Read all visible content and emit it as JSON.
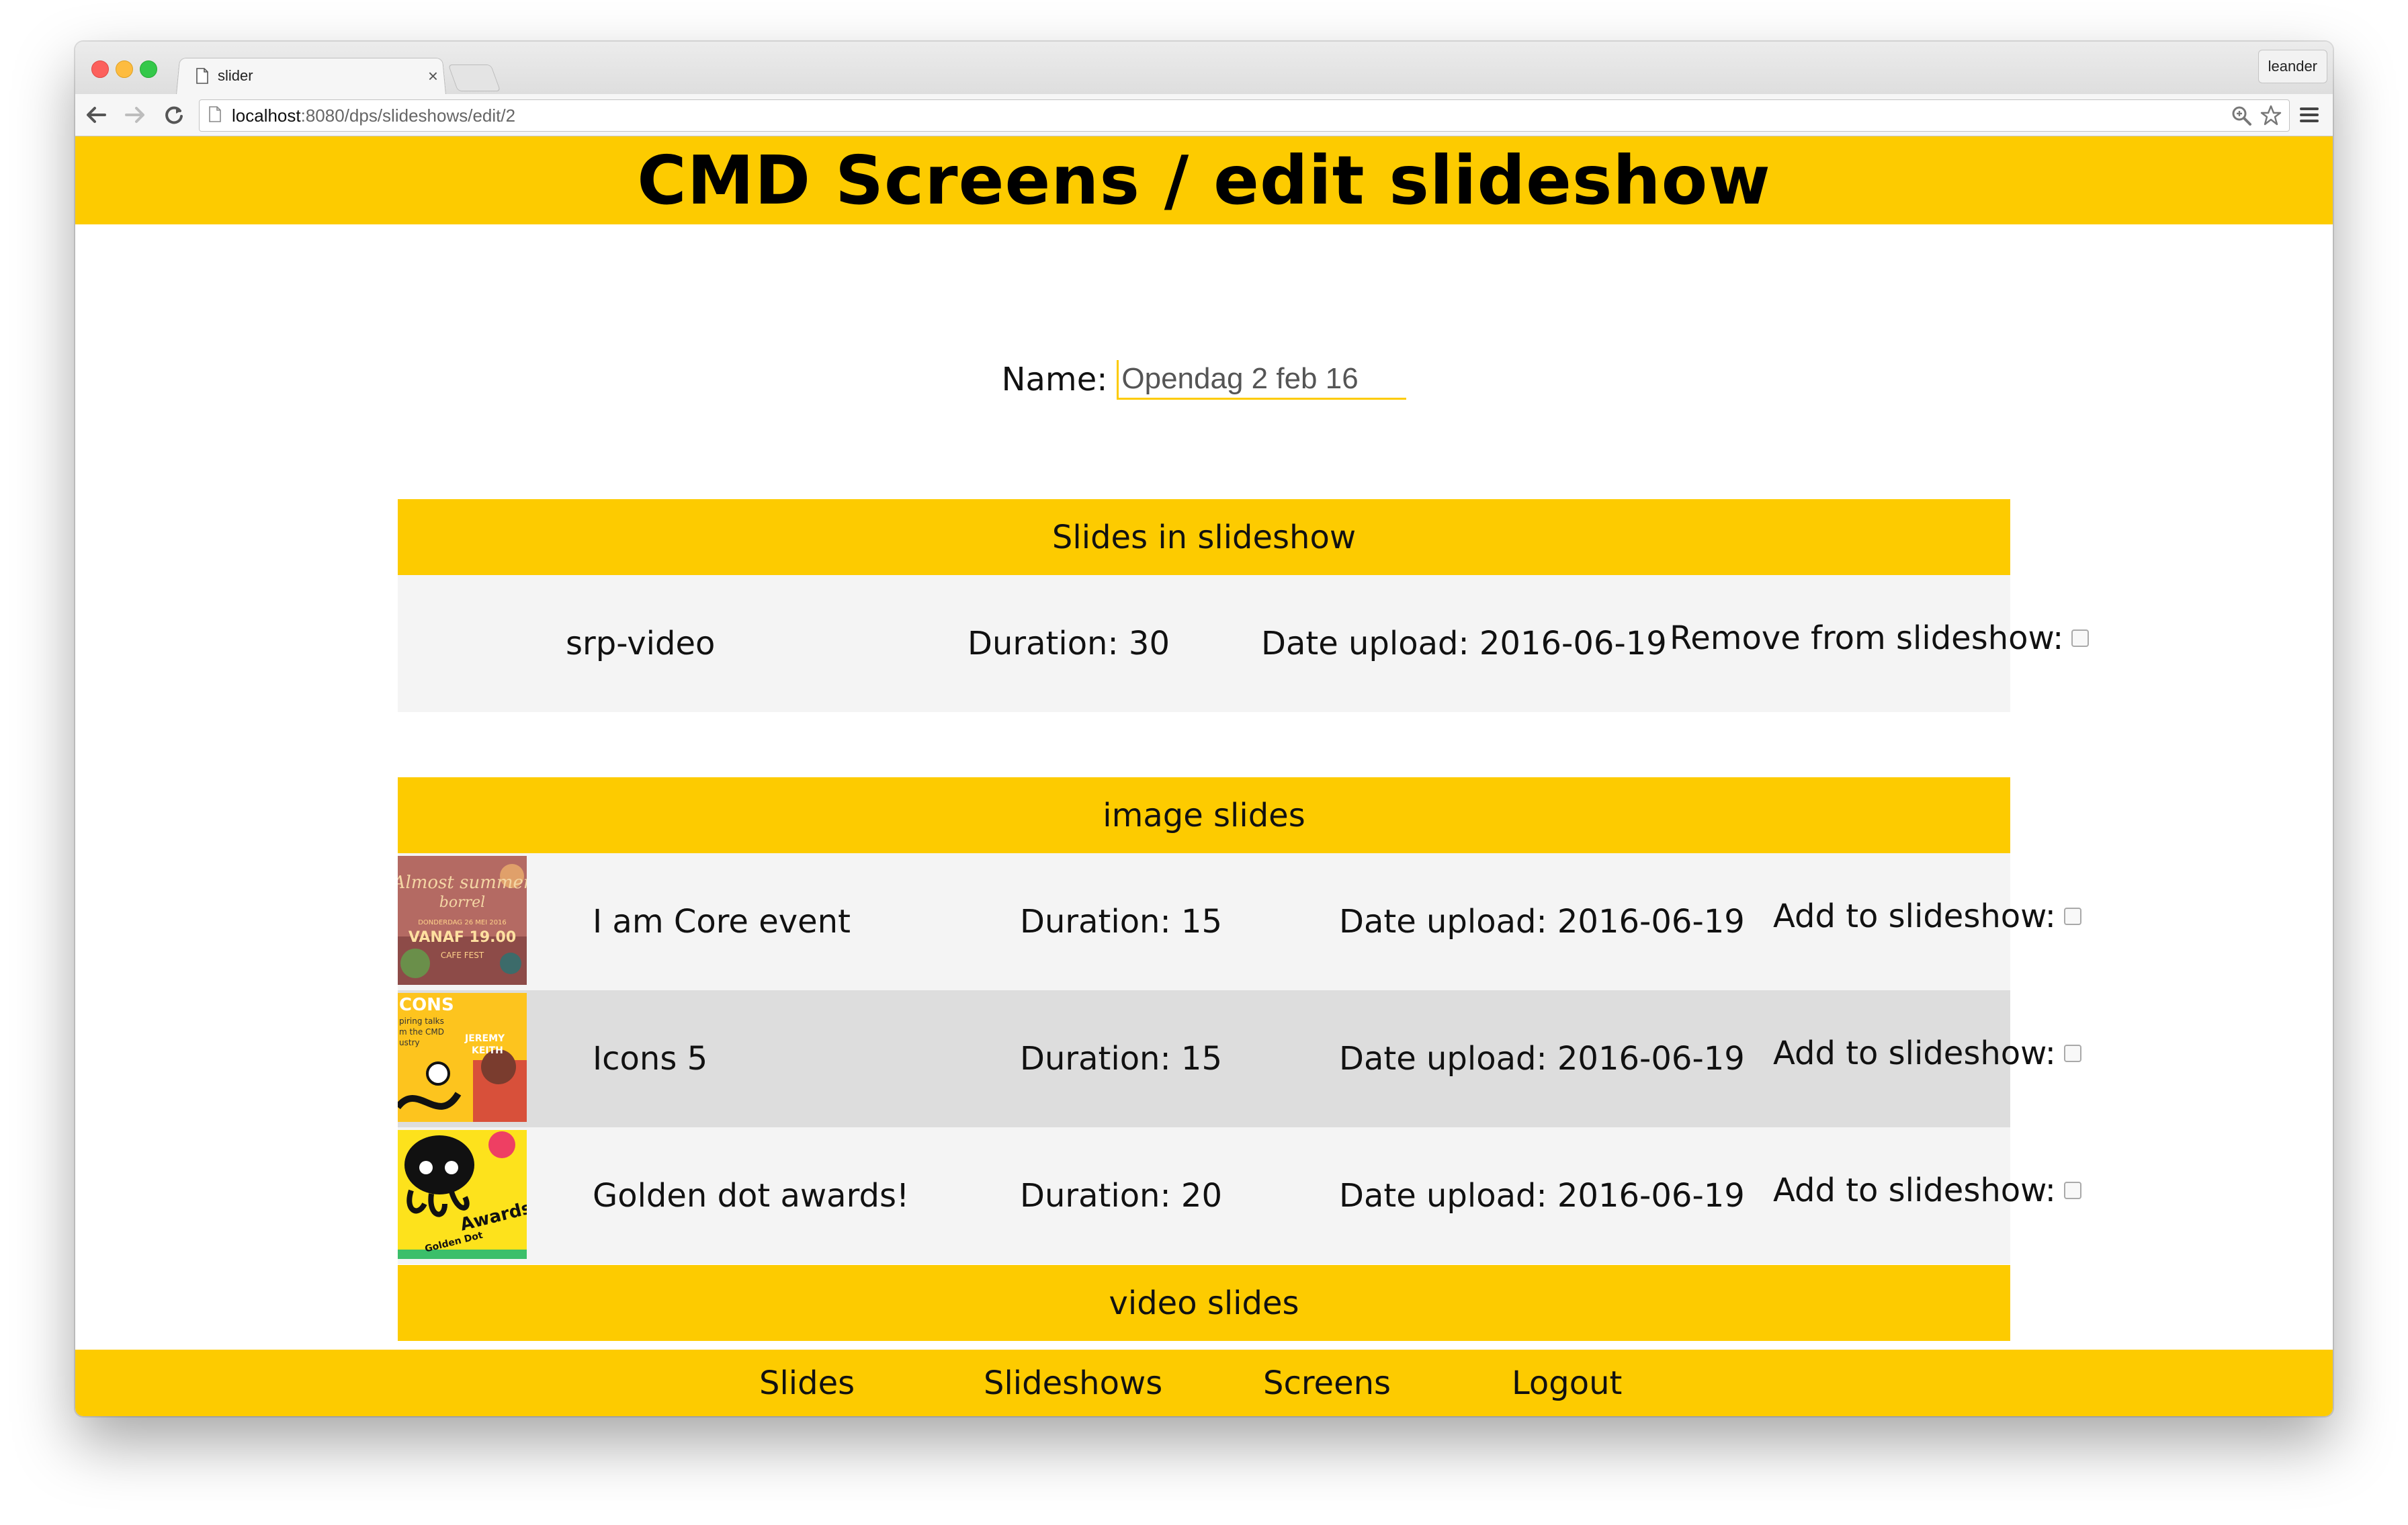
{
  "browser": {
    "tab_title": "slider",
    "tab_close": "×",
    "profile_name": "leander",
    "url_host": "localhost",
    "url_rest": ":8080/dps/slideshows/edit/2"
  },
  "page": {
    "title": "CMD Screens / edit slideshow",
    "name_label": "Name:",
    "name_value": "Opendag 2 feb 16"
  },
  "slides_in_slideshow": {
    "heading": "Slides in slideshow",
    "items": [
      {
        "name": "srp-video",
        "duration": "Duration: 30",
        "date": "Date upload: 2016-06-19",
        "action": "Remove from slideshow:",
        "checked": false
      }
    ]
  },
  "image_slides": {
    "heading": "image slides",
    "items": [
      {
        "name": "I am Core event",
        "duration": "Duration: 15",
        "date": "Date upload: 2016-06-19",
        "action": "Add to slideshow:",
        "thumb_text": [
          "Almost summer",
          "borrel",
          "DONDERDAG 26 MEI 2016",
          "VANAF 19.00",
          "CAFE FEST"
        ],
        "checked": false
      },
      {
        "name": "Icons 5",
        "duration": "Duration: 15",
        "date": "Date upload: 2016-06-19",
        "action": "Add to slideshow:",
        "thumb_text": [
          "CONS",
          "piring talks",
          "m the CMD",
          "ustry",
          "JEREMY",
          "KEITH"
        ],
        "checked": false
      },
      {
        "name": "Golden dot awards!",
        "duration": "Duration: 20",
        "date": "Date upload: 2016-06-19",
        "action": "Add to slideshow:",
        "thumb_text": [
          "Golden Dot",
          "Awards"
        ],
        "checked": false
      }
    ]
  },
  "video_slides": {
    "heading": "video slides"
  },
  "footer": {
    "links": [
      "Slides",
      "Slideshows",
      "Screens",
      "Logout"
    ]
  },
  "colors": {
    "accent": "#fdcb00",
    "row_light": "#f4f4f4",
    "row_dark": "#dddddd"
  }
}
